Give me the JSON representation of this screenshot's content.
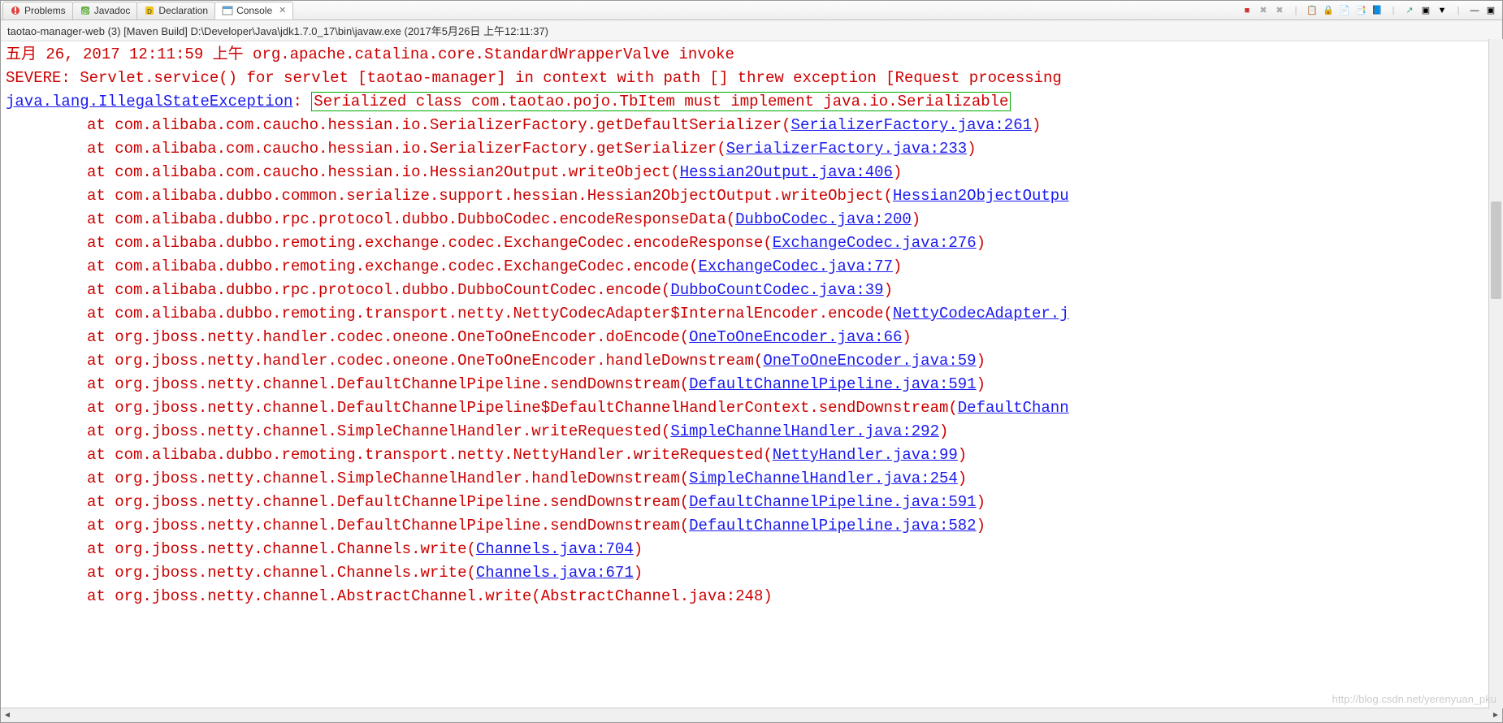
{
  "tabs": [
    {
      "label": "Problems",
      "icon": "problems-icon"
    },
    {
      "label": "Javadoc",
      "icon": "javadoc-icon"
    },
    {
      "label": "Declaration",
      "icon": "declaration-icon"
    },
    {
      "label": "Console",
      "icon": "console-icon",
      "active": true,
      "closable": true
    }
  ],
  "toolbar_icons": [
    "■",
    "✖",
    "✖",
    "|",
    "📋",
    "🔒",
    "📄",
    "📑",
    "📘",
    "|",
    "↗",
    "▣",
    "▼",
    "|",
    "—",
    "▣"
  ],
  "process_line": "taotao-manager-web (3) [Maven Build] D:\\Developer\\Java\\jdk1.7.0_17\\bin\\javaw.exe (2017年5月26日 上午12:11:37)",
  "log": {
    "l1": "五月 26, 2017 12:11:59 上午 org.apache.catalina.core.StandardWrapperValve invoke",
    "l2": "SEVERE: Servlet.service() for servlet [taotao-manager] in context with path [] threw exception [Request processing",
    "l3_link": "java.lang.IllegalStateException",
    "l3_colon": ": ",
    "l3_box": "Serialized class com.taotao.pojo.TbItem must implement java.io.Serializable",
    "traces": [
      {
        "pre": "at com.alibaba.com.caucho.hessian.io.SerializerFactory.getDefaultSerializer(",
        "link": "SerializerFactory.java:261",
        "post": ")"
      },
      {
        "pre": "at com.alibaba.com.caucho.hessian.io.SerializerFactory.getSerializer(",
        "link": "SerializerFactory.java:233",
        "post": ")"
      },
      {
        "pre": "at com.alibaba.com.caucho.hessian.io.Hessian2Output.writeObject(",
        "link": "Hessian2Output.java:406",
        "post": ")"
      },
      {
        "pre": "at com.alibaba.dubbo.common.serialize.support.hessian.Hessian2ObjectOutput.writeObject(",
        "link": "Hessian2ObjectOutpu",
        "post": ""
      },
      {
        "pre": "at com.alibaba.dubbo.rpc.protocol.dubbo.DubboCodec.encodeResponseData(",
        "link": "DubboCodec.java:200",
        "post": ")"
      },
      {
        "pre": "at com.alibaba.dubbo.remoting.exchange.codec.ExchangeCodec.encodeResponse(",
        "link": "ExchangeCodec.java:276",
        "post": ")"
      },
      {
        "pre": "at com.alibaba.dubbo.remoting.exchange.codec.ExchangeCodec.encode(",
        "link": "ExchangeCodec.java:77",
        "post": ")"
      },
      {
        "pre": "at com.alibaba.dubbo.rpc.protocol.dubbo.DubboCountCodec.encode(",
        "link": "DubboCountCodec.java:39",
        "post": ")"
      },
      {
        "pre": "at com.alibaba.dubbo.remoting.transport.netty.NettyCodecAdapter$InternalEncoder.encode(",
        "link": "NettyCodecAdapter.j",
        "post": ""
      },
      {
        "pre": "at org.jboss.netty.handler.codec.oneone.OneToOneEncoder.doEncode(",
        "link": "OneToOneEncoder.java:66",
        "post": ")"
      },
      {
        "pre": "at org.jboss.netty.handler.codec.oneone.OneToOneEncoder.handleDownstream(",
        "link": "OneToOneEncoder.java:59",
        "post": ")"
      },
      {
        "pre": "at org.jboss.netty.channel.DefaultChannelPipeline.sendDownstream(",
        "link": "DefaultChannelPipeline.java:591",
        "post": ")"
      },
      {
        "pre": "at org.jboss.netty.channel.DefaultChannelPipeline$DefaultChannelHandlerContext.sendDownstream(",
        "link": "DefaultChann",
        "post": ""
      },
      {
        "pre": "at org.jboss.netty.channel.SimpleChannelHandler.writeRequested(",
        "link": "SimpleChannelHandler.java:292",
        "post": ")"
      },
      {
        "pre": "at com.alibaba.dubbo.remoting.transport.netty.NettyHandler.writeRequested(",
        "link": "NettyHandler.java:99",
        "post": ")"
      },
      {
        "pre": "at org.jboss.netty.channel.SimpleChannelHandler.handleDownstream(",
        "link": "SimpleChannelHandler.java:254",
        "post": ")"
      },
      {
        "pre": "at org.jboss.netty.channel.DefaultChannelPipeline.sendDownstream(",
        "link": "DefaultChannelPipeline.java:591",
        "post": ")"
      },
      {
        "pre": "at org.jboss.netty.channel.DefaultChannelPipeline.sendDownstream(",
        "link": "DefaultChannelPipeline.java:582",
        "post": ")"
      },
      {
        "pre": "at org.jboss.netty.channel.Channels.write(",
        "link": "Channels.java:704",
        "post": ")"
      },
      {
        "pre": "at org.jboss.netty.channel.Channels.write(",
        "link": "Channels.java:671",
        "post": ")"
      },
      {
        "pre": "at org.jboss.netty.channel.AbstractChannel.write(",
        "link_plain": "AbstractChannel.java:248",
        "post": ")"
      }
    ]
  },
  "watermark": "http://blog.csdn.net/yerenyuan_pku"
}
